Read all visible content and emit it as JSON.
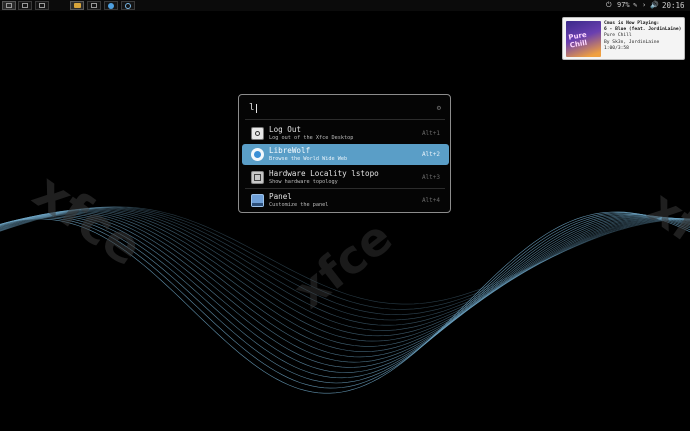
{
  "taskbar": {
    "clock": "20:16",
    "battery": "97%",
    "tray_icons": [
      "power-icon",
      "battery-icon",
      "pen-icon",
      "chevron-right-icon",
      "volume-icon"
    ]
  },
  "notification": {
    "title": "Cmus is Now Playing:",
    "track": "6 - Blue (feat. JordinLaine)",
    "album": "Pure Chill",
    "artist": "By Sk3n, JordinLaine",
    "time": "1:00/3:58",
    "art_text": "Pure Chill"
  },
  "wallpaper": {
    "brand": "xfce"
  },
  "launcher": {
    "query": "l",
    "results": [
      {
        "name": "Log Out",
        "desc": "Log out of the Xfce Desktop",
        "key": "Alt+1",
        "icon": "logout-icon"
      },
      {
        "name": "LibreWolf",
        "desc": "Browse the World Wide Web",
        "key": "Alt+2",
        "icon": "librewolf-icon"
      },
      {
        "name": "Hardware Locality lstopo",
        "desc": "Show hardware topology",
        "key": "Alt+3",
        "icon": "hardware-icon"
      },
      {
        "name": "Panel",
        "desc": "Customize the panel",
        "key": "Alt+4",
        "icon": "panel-icon"
      }
    ]
  },
  "colors": {
    "accent": "#5a9ec7",
    "wave": "#6fa6c6"
  }
}
